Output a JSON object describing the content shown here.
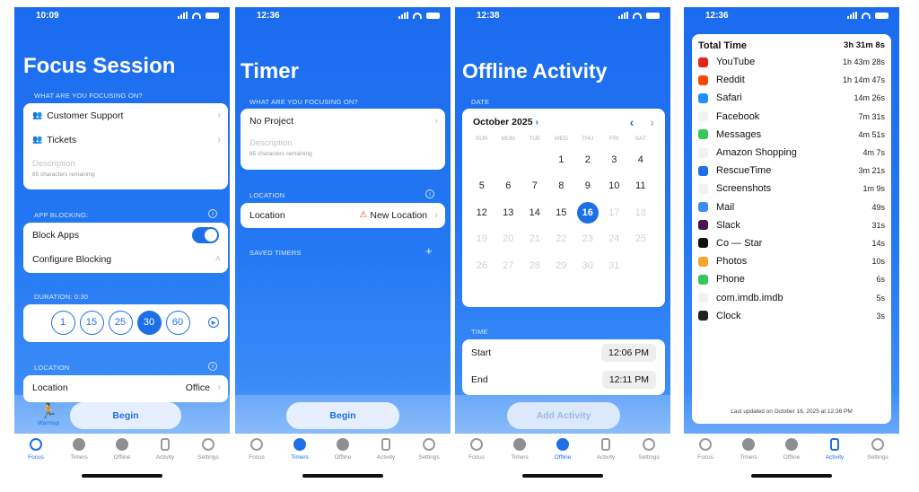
{
  "screen1": {
    "status_time": "10:09",
    "title": "Focus Session",
    "focus_label": "WHAT ARE YOU FOCUSING ON?",
    "projects": [
      "Customer Support",
      "Tickets"
    ],
    "description_placeholder": "Description",
    "char_remaining": "85 characters remaining",
    "app_blocking_label": "APP BLOCKING:",
    "block_apps": "Block Apps",
    "configure_blocking": "Configure Blocking",
    "duration_label": "DURATION: 0:30",
    "durations": [
      "1",
      "15",
      "25",
      "30",
      "60"
    ],
    "duration_selected": "30",
    "location_label": "LOCATION",
    "location_row": "Location",
    "location_value": "Office",
    "warmup": "Warmup",
    "begin": "Begin",
    "active_tab": "Focus"
  },
  "screen2": {
    "status_time": "12:36",
    "title": "Timer",
    "focus_label": "WHAT ARE YOU FOCUSING ON?",
    "project": "No Project",
    "description_placeholder": "Description",
    "char_remaining": "85 characters remaining",
    "location_label": "LOCATION",
    "location_row": "Location",
    "location_value": "New Location",
    "saved_timers": "SAVED TIMERS",
    "begin": "Begin",
    "active_tab": "Timers"
  },
  "screen3": {
    "status_time": "12:38",
    "title": "Offline Activity",
    "date_label": "DATE",
    "month": "October 2025",
    "weekdays": [
      "SUN",
      "MON",
      "TUE",
      "WED",
      "THU",
      "FRI",
      "SAT"
    ],
    "days": [
      [
        "",
        "",
        "",
        "1",
        "2",
        "3",
        "4"
      ],
      [
        "5",
        "6",
        "7",
        "8",
        "9",
        "10",
        "11"
      ],
      [
        "12",
        "13",
        "14",
        "15",
        "16",
        "17",
        "18"
      ],
      [
        "19",
        "20",
        "21",
        "22",
        "23",
        "24",
        "25"
      ],
      [
        "26",
        "27",
        "28",
        "29",
        "30",
        "31",
        ""
      ]
    ],
    "selected_day": "16",
    "time_label": "TIME",
    "start_label": "Start",
    "start_value": "12:06 PM",
    "end_label": "End",
    "end_value": "12:11 PM",
    "add_activity": "Add Activity",
    "active_tab": "Offline"
  },
  "screen4": {
    "status_time": "12:36",
    "total_label": "Total Time",
    "total_value": "3h 31m 8s",
    "apps": [
      {
        "name": "YouTube",
        "time": "1h 43m 28s",
        "color": "#e62117"
      },
      {
        "name": "Reddit",
        "time": "1h 14m 47s",
        "color": "#ff4500"
      },
      {
        "name": "Safari",
        "time": "14m 26s",
        "color": "#1e90ff"
      },
      {
        "name": "Facebook",
        "time": "7m 31s",
        "color": "#f2f2f2"
      },
      {
        "name": "Messages",
        "time": "4m 51s",
        "color": "#34c759"
      },
      {
        "name": "Amazon Shopping",
        "time": "4m 7s",
        "color": "#f2f2f2"
      },
      {
        "name": "RescueTime",
        "time": "3m 21s",
        "color": "#1d6fe8"
      },
      {
        "name": "Screenshots",
        "time": "1m 9s",
        "color": "#f2f2f2"
      },
      {
        "name": "Mail",
        "time": "49s",
        "color": "#3a8ef6"
      },
      {
        "name": "Slack",
        "time": "31s",
        "color": "#4a154b"
      },
      {
        "name": "Co — Star",
        "time": "14s",
        "color": "#111111"
      },
      {
        "name": "Photos",
        "time": "10s",
        "color": "#f4a62a"
      },
      {
        "name": "Phone",
        "time": "6s",
        "color": "#34c759"
      },
      {
        "name": "com.imdb.imdb",
        "time": "5s",
        "color": "#f2f2f2"
      },
      {
        "name": "Clock",
        "time": "3s",
        "color": "#222222"
      }
    ],
    "updated": "Last updated on October 16, 2025 at 12:36 PM",
    "active_tab": "Activity"
  },
  "tabs": [
    "Focus",
    "Timers",
    "Offline",
    "Activity",
    "Settings"
  ]
}
